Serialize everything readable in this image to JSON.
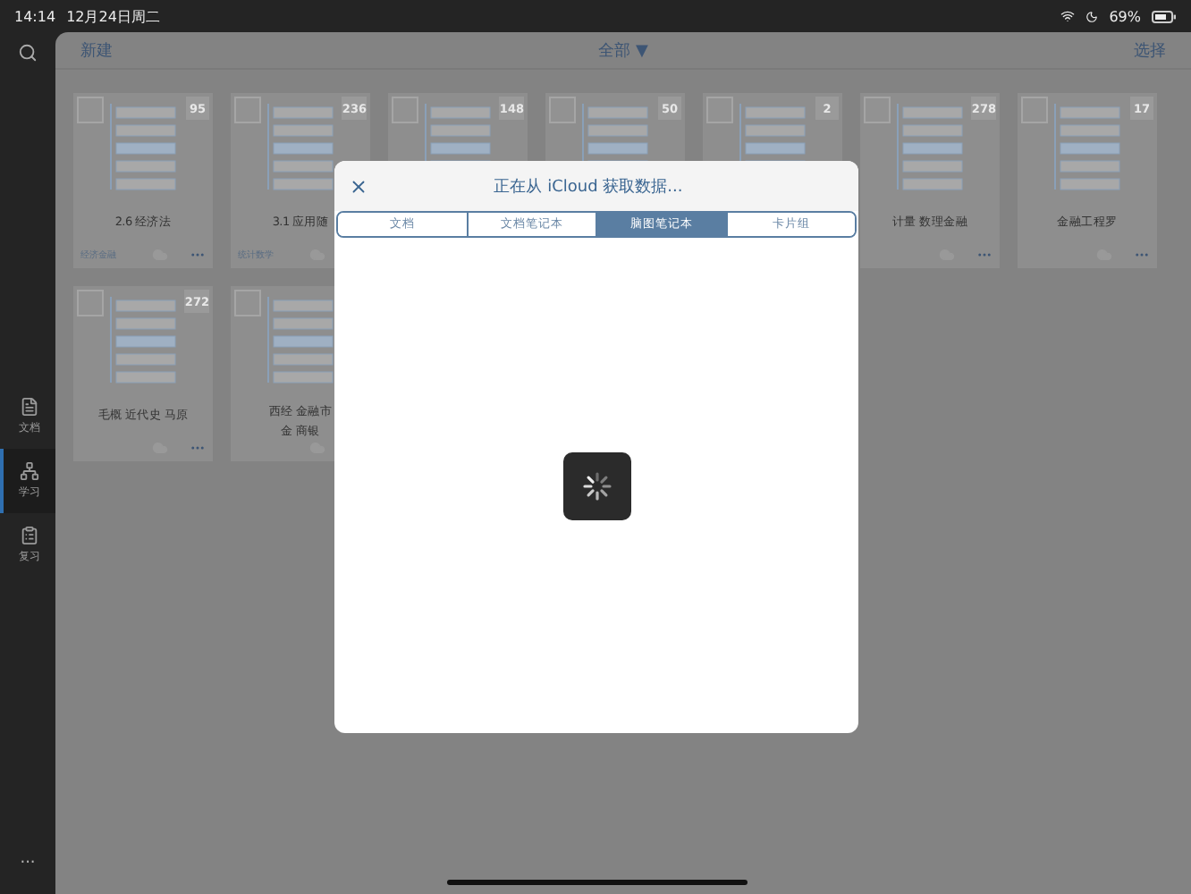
{
  "status_bar": {
    "time": "14:14",
    "date": "12月24日周二",
    "battery": "69%"
  },
  "sidebar": {
    "items": [
      {
        "kind": "document",
        "label": "文档",
        "selected": false
      },
      {
        "kind": "mindmap",
        "label": "学习",
        "selected": true
      },
      {
        "kind": "review",
        "label": "复习",
        "selected": false
      }
    ],
    "more": "···"
  },
  "toolbar": {
    "new": "新建",
    "filter": "全部 ▼",
    "select": "选择"
  },
  "cards": [
    {
      "kind": "full",
      "count": "95",
      "title": "2.6 经济法",
      "tag": "经济金融"
    },
    {
      "kind": "cut",
      "count": "236",
      "title": "3.1 应用随",
      "tag": "统计数学"
    },
    {
      "kind": "top",
      "count": "148"
    },
    {
      "kind": "top",
      "count": "50"
    },
    {
      "kind": "top",
      "count": "2"
    },
    {
      "kind": "full",
      "count": "278",
      "title": "计量 数理金融"
    },
    {
      "kind": "full",
      "count": "17",
      "title": "金融工程罗"
    },
    {
      "kind": "full",
      "count": "272",
      "title": "毛概 近代史 马原"
    },
    {
      "kind": "cut",
      "title_lines": [
        "西经 金融市",
        "金 商银"
      ]
    }
  ],
  "modal": {
    "title": "正在从 iCloud 获取数据...",
    "tabs": [
      {
        "label": "文档",
        "selected": false
      },
      {
        "label": "文档笔记本",
        "selected": false
      },
      {
        "label": "脑图笔记本",
        "selected": true
      },
      {
        "label": "卡片组",
        "selected": false
      }
    ]
  }
}
